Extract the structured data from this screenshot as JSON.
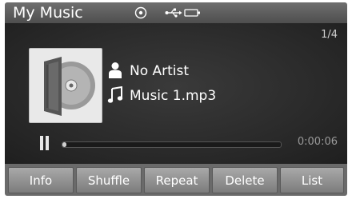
{
  "header": {
    "title": "My Music",
    "status_icons": [
      "disc-icon",
      "usb-icon",
      "battery-icon"
    ]
  },
  "player": {
    "track_counter": "1/4",
    "artist": "No Artist",
    "song": "Music 1.mp3",
    "elapsed_time": "0:00:06",
    "progress": 0.02,
    "state": "playing"
  },
  "buttons": {
    "info": "Info",
    "shuffle": "Shuffle",
    "repeat": "Repeat",
    "delete": "Delete",
    "list": "List"
  },
  "colors": {
    "header_bg": "#5e5e5e",
    "main_bg": "#2a2a2a",
    "button_bg": "#9a9a9a",
    "text": "#ffffff"
  }
}
